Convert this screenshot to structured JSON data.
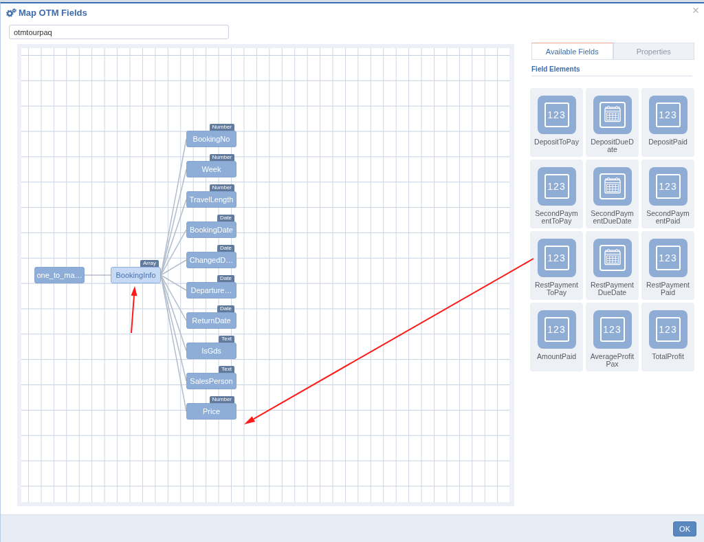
{
  "window": {
    "title": "Map OTM Fields"
  },
  "search": {
    "value": "otmtourpaq"
  },
  "diagram": {
    "nodes": [
      {
        "label": "one_to_ma…",
        "selected": false,
        "children": [
          {
            "label": "BookingInfo",
            "type": "Array",
            "selected": true,
            "children": [
              {
                "label": "BookingNo",
                "type": "Number",
                "selected": false
              },
              {
                "label": "Week",
                "type": "Number",
                "selected": false
              },
              {
                "label": "TravelLength",
                "type": "Number",
                "selected": false
              },
              {
                "label": "BookingDate",
                "type": "Date",
                "selected": false
              },
              {
                "label": "ChangedD…",
                "type": "Date",
                "selected": false
              },
              {
                "label": "Departure…",
                "type": "Date",
                "selected": false
              },
              {
                "label": "ReturnDate",
                "type": "Date",
                "selected": false
              },
              {
                "label": "IsGds",
                "type": "Text",
                "selected": false
              },
              {
                "label": "SalesPerson",
                "type": "Text",
                "selected": false
              },
              {
                "label": "Price",
                "type": "Number",
                "selected": false
              }
            ]
          }
        ]
      }
    ]
  },
  "tabs": [
    {
      "label": "Available Fields",
      "selected": true
    },
    {
      "label": "Properties",
      "selected": false
    }
  ],
  "field_elements": {
    "title": "Field Elements",
    "items": [
      {
        "label": "DepositToPay",
        "kind": "number",
        "icon_text": "123"
      },
      {
        "label": "DepositDueDate",
        "kind": "date"
      },
      {
        "label": "DepositPaid",
        "kind": "number",
        "icon_text": "123"
      },
      {
        "label": "SecondPaymentToPay",
        "kind": "number",
        "icon_text": "123"
      },
      {
        "label": "SecondPaymentDueDate",
        "kind": "date"
      },
      {
        "label": "SecondPaymentPaid",
        "kind": "number",
        "icon_text": "123"
      },
      {
        "label": "RestPaymentToPay",
        "kind": "number",
        "icon_text": "123"
      },
      {
        "label": "RestPaymentDueDate",
        "kind": "date"
      },
      {
        "label": "RestPaymentPaid",
        "kind": "number",
        "icon_text": "123"
      },
      {
        "label": "AmountPaid",
        "kind": "number",
        "icon_text": "123"
      },
      {
        "label": "AverageProfitPax",
        "kind": "number",
        "icon_text": "123"
      },
      {
        "label": "TotalProfit",
        "kind": "number",
        "icon_text": "123"
      }
    ]
  },
  "buttons": [
    {
      "label": "OK"
    }
  ]
}
